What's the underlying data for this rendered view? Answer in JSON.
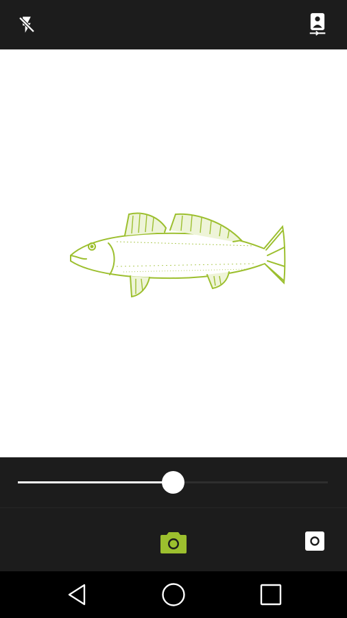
{
  "top_bar": {
    "flash_icon": "flash-off-icon",
    "switch_camera_icon": "switch-camera-icon"
  },
  "viewfinder": {
    "subject": "fish-illustration",
    "subject_color": "#9cbf2e"
  },
  "zoom_slider": {
    "value": 0.5,
    "track_color": "#2e2e2e",
    "fill_color": "#ffffff"
  },
  "controls": {
    "shutter_icon": "camera-icon",
    "shutter_color": "#9cbf2e",
    "mode_icon": "record-mode-icon"
  },
  "nav_bar": {
    "back_icon": "back-icon",
    "home_icon": "home-icon",
    "recents_icon": "recents-icon"
  },
  "colors": {
    "bar_background": "#1c1c1c",
    "nav_background": "#000000",
    "accent": "#9cbf2e"
  }
}
